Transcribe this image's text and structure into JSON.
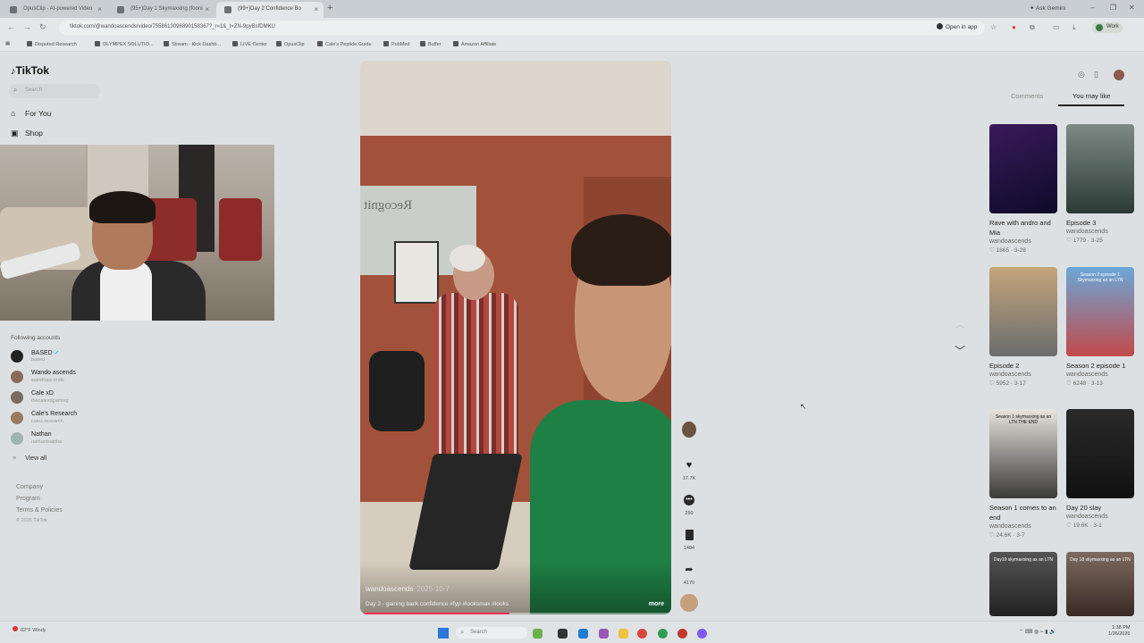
{
  "browser": {
    "tabs": [
      {
        "label": "OpusClip - AI-powered Video"
      },
      {
        "label": "(95+)Day 1 Skymaxxing (fooni"
      },
      {
        "label": "(99+)Day 2 Confidence Bo"
      }
    ],
    "ask_gemini": "Ask Gemini",
    "url": "tiktok.com/@wandoascends/video/7558613096890158367?_r=1&_t=ZN-9pyBsfDMKU",
    "open_in_app": "Open in app",
    "profile_label": "Work",
    "bookmarks": [
      "Disputed Research",
      "OLYMPEX SOLUTIO...",
      "Stream - Kick Dashb...",
      "LIVE Center",
      "OpusClip",
      "Cale's Peptide Guide",
      "PubMed",
      "Buffer",
      "Amazon Affiliate"
    ]
  },
  "sidebar": {
    "logo": "TikTok",
    "search_placeholder": "Search",
    "nav": [
      {
        "label": "For You",
        "icon": "home-icon"
      },
      {
        "label": "Shop",
        "icon": "shop-icon"
      }
    ],
    "following_title": "Following accounts",
    "accounts": [
      {
        "name": "BASED",
        "handle": "based",
        "verified": true
      },
      {
        "name": "Wando ascends",
        "handle": "wandoascends"
      },
      {
        "name": "Cale xD",
        "handle": "thecalexdgaming"
      },
      {
        "name": "Cale's Research",
        "handle": "cales.research"
      },
      {
        "name": "Nathan",
        "handle": "nathanisalpha"
      }
    ],
    "view_all": "View all",
    "footer": [
      "Company",
      "Program",
      "Terms & Policies"
    ],
    "copyright": "© 2026 TikTok"
  },
  "video": {
    "author": "wandoascends",
    "date": "2025-10-7",
    "caption": "Day 2 - gaining back confidence #fyp #looksmax #looks",
    "more_label": "more",
    "progress": 0.48,
    "sign_text": "Recognit"
  },
  "actions": {
    "likes": "17.7K",
    "comments": "250",
    "saves": "1404",
    "shares": "4170"
  },
  "right_panel": {
    "tabs": [
      "Comments",
      "You may like"
    ],
    "active_tab": "You may like",
    "cards": [
      {
        "title": "Rave with andro and Mia",
        "author": "wandoascends",
        "meta": "1865 · 3-28",
        "overlay": ""
      },
      {
        "title": "Episode 3",
        "author": "wandoascends",
        "meta": "1779 · 3-25",
        "overlay": ""
      },
      {
        "title": "Episode 2",
        "author": "wandoascends",
        "meta": "5952 · 3-17",
        "overlay": ""
      },
      {
        "title": "Season 2 episode 1",
        "author": "wandoascends",
        "meta": "6248 · 3-13",
        "overlay": "Season 2 episode 1 Skymaxxing as an LTN"
      },
      {
        "title": "Season 1 comes to an end",
        "author": "wandoascends",
        "meta": "24.6K · 3-7",
        "overlay": "Season 1 skymaxxing as an LTN THE END"
      },
      {
        "title": "Day 20 slay",
        "author": "wandoascends",
        "meta": "19.6K · 3-1",
        "overlay": ""
      },
      {
        "title": "",
        "author": "",
        "meta": "",
        "overlay": "Day19 skymaxxing as an LTN"
      },
      {
        "title": "",
        "author": "",
        "meta": "",
        "overlay": "Day 18 skymaxxing as an LTN"
      }
    ]
  },
  "taskbar": {
    "weather_temp": "82°F",
    "weather_desc": "Windy",
    "search_placeholder": "Search",
    "time": "1:38 PM",
    "date": "1/26/2026"
  }
}
